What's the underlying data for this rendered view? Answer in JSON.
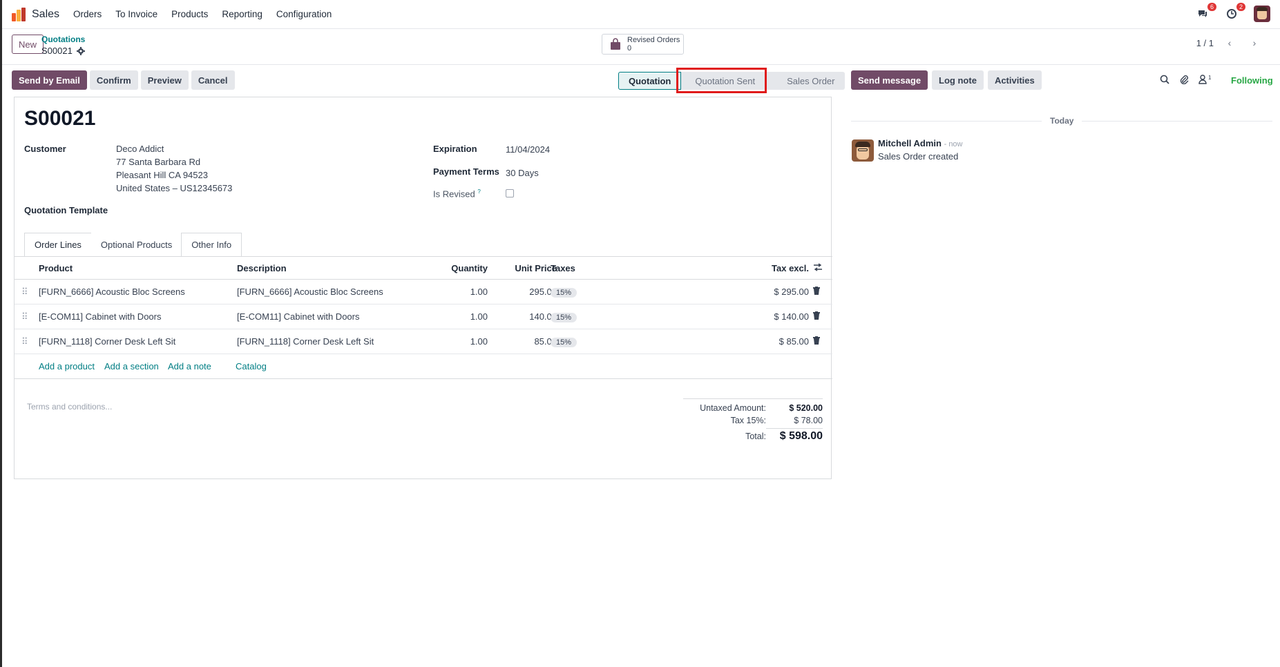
{
  "navbar": {
    "app_name": "Sales",
    "menu": [
      "Orders",
      "To Invoice",
      "Products",
      "Reporting",
      "Configuration"
    ],
    "messages_badge": "6",
    "activities_badge": "2"
  },
  "control": {
    "new_label": "New",
    "breadcrumb_parent": "Quotations",
    "breadcrumb_current": "S00021",
    "revised_label": "Revised Orders",
    "revised_count": "0",
    "pager": "1 / 1"
  },
  "actions": {
    "send_email": "Send by Email",
    "confirm": "Confirm",
    "preview": "Preview",
    "cancel": "Cancel"
  },
  "stages": [
    "Quotation",
    "Quotation Sent",
    "Sales Order"
  ],
  "form": {
    "name": "S00021",
    "customer_label": "Customer",
    "customer_name": "Deco Addict",
    "customer_street": "77 Santa Barbara Rd",
    "customer_city": "Pleasant Hill CA 94523",
    "customer_country": "United States – US12345673",
    "template_label": "Quotation Template",
    "expiration_label": "Expiration",
    "expiration_value": "11/04/2024",
    "payment_label": "Payment Terms",
    "payment_value": "30 Days",
    "revised_label": "Is Revised",
    "revised_help": "?"
  },
  "tabs": [
    "Order Lines",
    "Optional Products",
    "Other Info"
  ],
  "table": {
    "headers": {
      "product": "Product",
      "description": "Description",
      "quantity": "Quantity",
      "unit_price": "Unit Price",
      "taxes": "Taxes",
      "tax_excl": "Tax excl."
    },
    "rows": [
      {
        "product": "[FURN_6666] Acoustic Bloc Screens",
        "description": "[FURN_6666] Acoustic Bloc Screens",
        "qty": "1.00",
        "price": "295.00",
        "tax": "15%",
        "subtotal": "$ 295.00"
      },
      {
        "product": "[E-COM11] Cabinet with Doors",
        "description": "[E-COM11] Cabinet with Doors",
        "qty": "1.00",
        "price": "140.00",
        "tax": "15%",
        "subtotal": "$ 140.00"
      },
      {
        "product": "[FURN_1118] Corner Desk Left Sit",
        "description": "[FURN_1118] Corner Desk Left Sit",
        "qty": "1.00",
        "price": "85.00",
        "tax": "15%",
        "subtotal": "$ 85.00"
      }
    ],
    "add_product": "Add a product",
    "add_section": "Add a section",
    "add_note": "Add a note",
    "catalog": "Catalog"
  },
  "terms_placeholder": "Terms and conditions...",
  "totals": {
    "untaxed_label": "Untaxed Amount:",
    "untaxed_value": "$ 520.00",
    "tax_label": "Tax 15%:",
    "tax_value": "$ 78.00",
    "total_label": "Total:",
    "total_value": "$ 598.00"
  },
  "chatter": {
    "send_message": "Send message",
    "log_note": "Log note",
    "activities": "Activities",
    "followers_count": "1",
    "following": "Following",
    "today": "Today",
    "author": "Mitchell Admin",
    "time": "- now",
    "body": "Sales Order created"
  },
  "colors": {
    "brand": "#714B67",
    "link": "#017e84",
    "highlight": "#e01a1a",
    "following": "#28a745"
  }
}
